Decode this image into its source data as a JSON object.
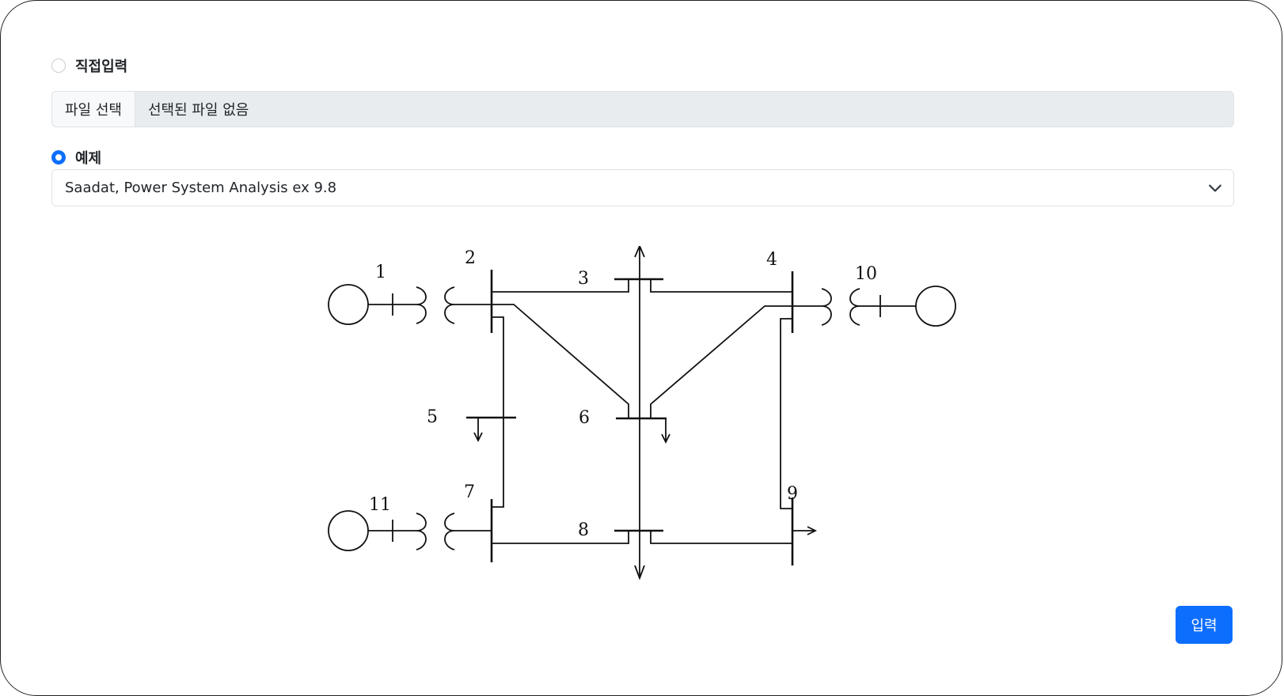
{
  "options": {
    "direct_input_label": "직접입력",
    "example_label": "예제",
    "selected": "example"
  },
  "file": {
    "button_label": "파일 선택",
    "status_text": "선택된 파일 없음"
  },
  "example_select": {
    "value": "Saadat, Power System Analysis ex 9.8"
  },
  "diagram": {
    "bus_labels": [
      "1",
      "2",
      "3",
      "4",
      "5",
      "6",
      "7",
      "8",
      "9",
      "10",
      "11"
    ]
  },
  "submit_label": "입력",
  "colors": {
    "accent": "#0d6efd",
    "file_bg": "#e9ecef",
    "border": "#dee2e6"
  }
}
